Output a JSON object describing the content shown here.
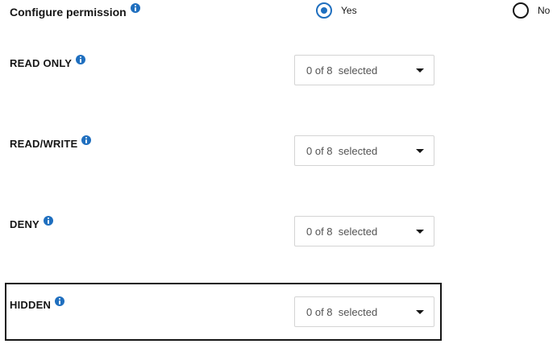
{
  "configure": {
    "title": "Configure permission",
    "options": [
      {
        "label": "Yes",
        "checked": true
      },
      {
        "label": "No",
        "checked": false
      }
    ]
  },
  "permissions": [
    {
      "label": "READ ONLY",
      "dropdown_value": "0 of 8  selected"
    },
    {
      "label": "READ/WRITE",
      "dropdown_value": "0 of 8  selected"
    },
    {
      "label": "DENY",
      "dropdown_value": "0 of 8  selected"
    },
    {
      "label": "HIDDEN",
      "dropdown_value": "0 of 8  selected"
    }
  ],
  "icons": {
    "info": "info-icon",
    "dropdown": "chevron-down-icon"
  },
  "colors": {
    "accent": "#1f6fbf",
    "text": "#161616",
    "muted": "#525252",
    "border": "#d4d4d4"
  }
}
